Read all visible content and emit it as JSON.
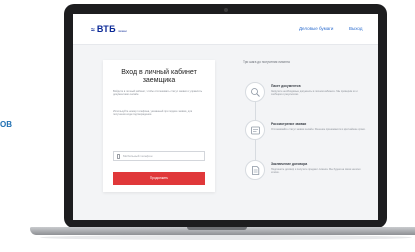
{
  "side_label": "ОВ",
  "brand": {
    "mark": "≈",
    "name": "ВТБ",
    "subtitle": "лизинг"
  },
  "nav": {
    "link1": "Деловые бумаги",
    "link2": "Выход"
  },
  "login": {
    "title": "Вход в личный кабинет заемщика",
    "desc1": "Войдите в личный кабинет, чтобы отслеживать статус заявки и управлять документами онлайн.",
    "desc2": "Используйте номер телефона, указанный при подаче заявки, для получения кода подтверждения.",
    "phone_placeholder": "Мобильный телефон",
    "submit_label": "Продолжить"
  },
  "steps": {
    "heading": "Три шага до получения лизинга",
    "items": [
      {
        "title": "Пакет документов",
        "text": "Загрузите необходимые документы в личном кабинете. Мы проверим их и сообщим о результатах."
      },
      {
        "title": "Рассмотрение заявки",
        "text": "Отслеживайте статус заявки онлайн. Решение принимается в кратчайшие сроки."
      },
      {
        "title": "Заключение договора",
        "text": "Подпишите договор и получите предмет лизинга. Мы будем на связи на всех этапах."
      }
    ]
  }
}
